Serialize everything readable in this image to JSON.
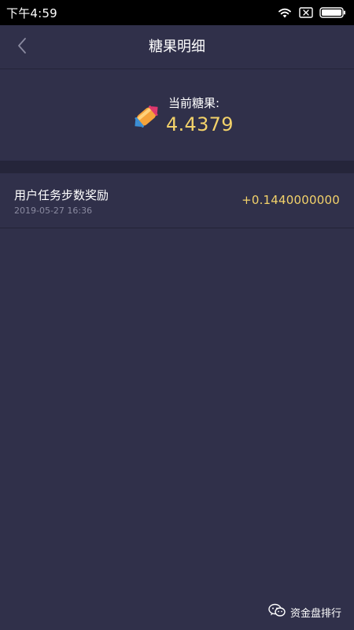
{
  "status_bar": {
    "time": "下午4:59",
    "icons": [
      "wifi-icon",
      "no-sim-icon",
      "battery-icon"
    ]
  },
  "nav": {
    "title": "糖果明细",
    "back_icon": "chevron-left-icon"
  },
  "balance": {
    "icon": "candy-icon",
    "label": "当前糖果:",
    "value": "4.4379"
  },
  "records": [
    {
      "title": "用户任务步数奖励",
      "time": "2019-05-27 16:36",
      "amount": "+0.1440000000"
    }
  ],
  "watermark": {
    "icon": "wechat-icon",
    "text": "资金盘排行"
  },
  "colors": {
    "background": "#30304a",
    "divider": "#25253a",
    "accent": "#f3d26a",
    "secondary_text": "#8a8aa0"
  }
}
